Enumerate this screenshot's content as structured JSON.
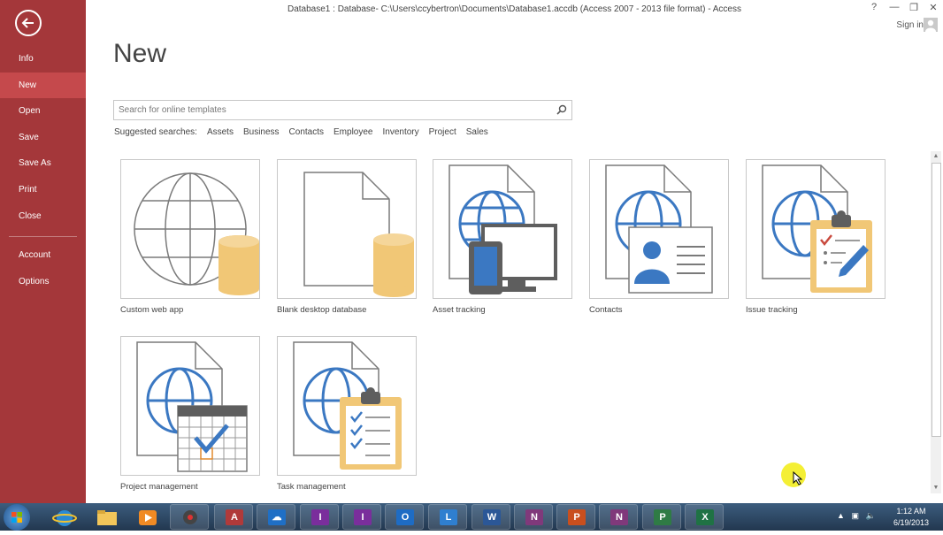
{
  "window": {
    "title": "Database1 : Database- C:\\Users\\ccybertron\\Documents\\Database1.accdb (Access 2007 - 2013 file format) - Access",
    "help": "?",
    "minimize": "—",
    "restore": "❐",
    "close": "✕",
    "sign_in": "Sign in"
  },
  "sidebar": {
    "items": [
      {
        "label": "Info"
      },
      {
        "label": "New",
        "active": true
      },
      {
        "label": "Open"
      },
      {
        "label": "Save"
      },
      {
        "label": "Save As"
      },
      {
        "label": "Print"
      },
      {
        "label": "Close"
      },
      {
        "label": "Account"
      },
      {
        "label": "Options"
      }
    ]
  },
  "main": {
    "title": "New",
    "search": {
      "placeholder": "Search for online templates"
    },
    "suggested": {
      "label": "Suggested searches:",
      "items": [
        "Assets",
        "Business",
        "Contacts",
        "Employee",
        "Inventory",
        "Project",
        "Sales"
      ]
    },
    "templates": [
      {
        "label": "Custom web app",
        "icon": "web-app-icon"
      },
      {
        "label": "Blank desktop database",
        "icon": "blank-database-icon"
      },
      {
        "label": "Asset tracking",
        "icon": "asset-tracking-icon"
      },
      {
        "label": "Contacts",
        "icon": "contacts-icon"
      },
      {
        "label": "Issue tracking",
        "icon": "issue-tracking-icon"
      },
      {
        "label": "Project management",
        "icon": "project-management-icon"
      },
      {
        "label": "Task management",
        "icon": "task-management-icon"
      }
    ]
  },
  "taskbar": {
    "time": "1:12 AM",
    "date": "6/19/2013",
    "apps": [
      {
        "glyph": "A",
        "color": "#b03a3a"
      },
      {
        "glyph": "☁",
        "color": "#1f6fc5"
      },
      {
        "glyph": "I",
        "color": "#7a2e9c"
      },
      {
        "glyph": "I",
        "color": "#7a2e9c"
      },
      {
        "glyph": "O",
        "color": "#1e6cc4"
      },
      {
        "glyph": "L",
        "color": "#2f7fd0"
      },
      {
        "glyph": "W",
        "color": "#2b5797"
      },
      {
        "glyph": "N",
        "color": "#80397b"
      },
      {
        "glyph": "P",
        "color": "#c94f1e"
      },
      {
        "glyph": "N",
        "color": "#80397b"
      },
      {
        "glyph": "P",
        "color": "#2f7b45"
      },
      {
        "glyph": "X",
        "color": "#1f7244"
      }
    ]
  },
  "colors": {
    "sidebar_bg": "#a4373a",
    "sidebar_active": "#c5494c",
    "globe": "#3b78c2",
    "cylinder": "#f1c776"
  }
}
